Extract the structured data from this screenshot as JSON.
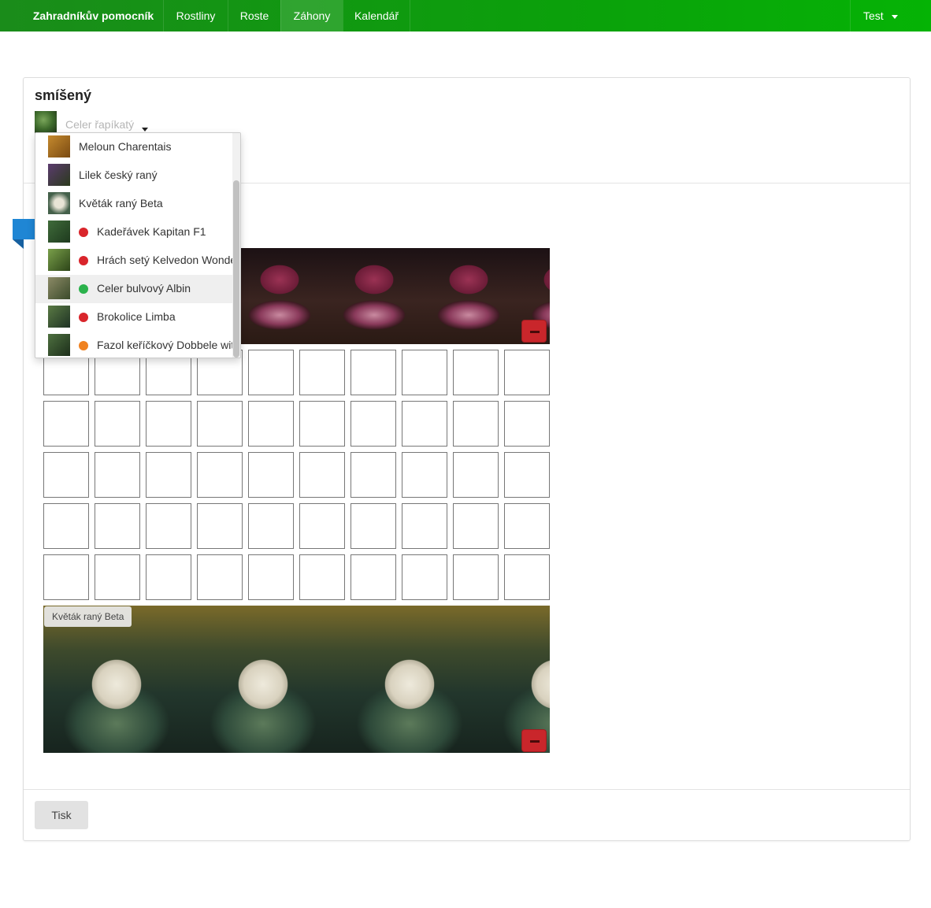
{
  "navbar": {
    "brand": "Zahradníkův pomocník",
    "items": [
      {
        "label": "Rostliny"
      },
      {
        "label": "Roste"
      },
      {
        "label": "Záhony"
      },
      {
        "label": "Kalendář"
      }
    ],
    "user": "Test"
  },
  "bed": {
    "title": "smíšený",
    "selector_value": "Celer řapíkatý",
    "bottom_strip_label": "Květák raný Beta",
    "grid": {
      "rows": 5,
      "cols": 10
    }
  },
  "dropdown": {
    "items": [
      {
        "label": "Meloun Charentais",
        "status": null
      },
      {
        "label": "Lilek český raný",
        "status": null
      },
      {
        "label": "Květák raný Beta",
        "status": null
      },
      {
        "label": "Kadeřávek Kapitan F1",
        "status": "red"
      },
      {
        "label": "Hrách setý Kelvedon Wonder",
        "status": "red"
      },
      {
        "label": "Celer bulvový Albin",
        "status": "green"
      },
      {
        "label": "Brokolice Limba",
        "status": "red"
      },
      {
        "label": "Fazol keříčkový Dobbele witte",
        "status": "orange"
      }
    ]
  },
  "footer": {
    "print_label": "Tisk"
  },
  "colors": {
    "red": "#d9252b",
    "green": "#2bb24c",
    "orange": "#f08220",
    "navbar": "#0ba00b",
    "marker": "#1f86d4"
  }
}
